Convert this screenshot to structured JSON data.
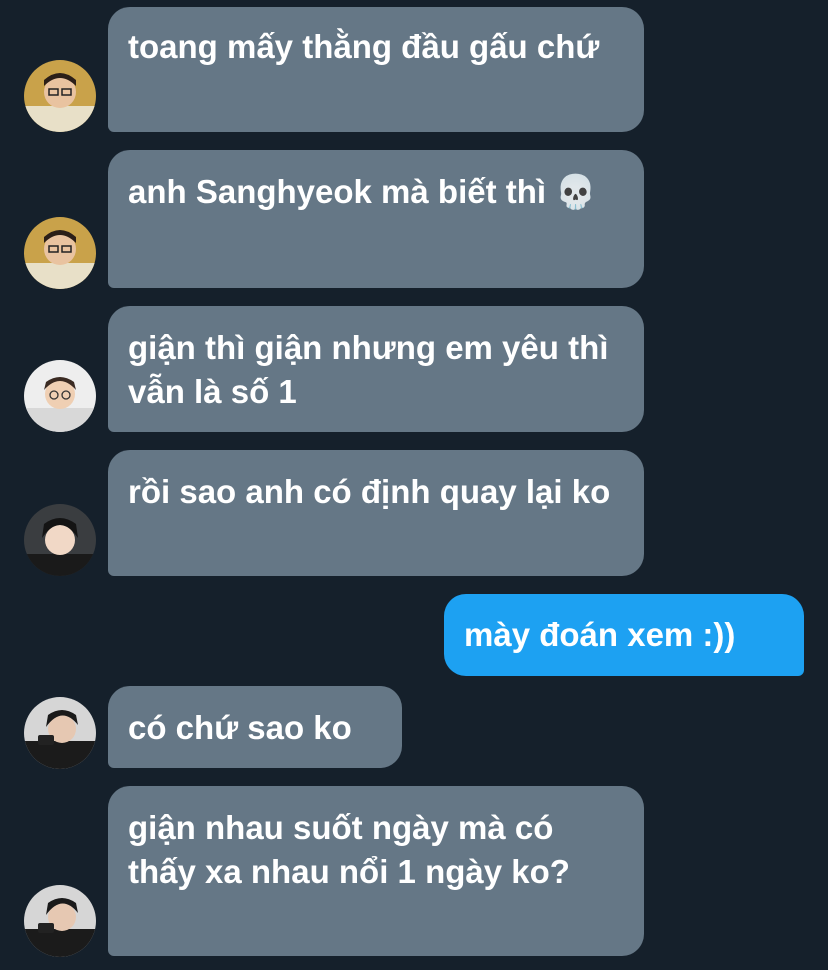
{
  "conversation": {
    "messages": [
      {
        "sender": "incoming",
        "text": "toang mấy thằng đầu gấu chứ"
      },
      {
        "sender": "incoming",
        "text": "anh Sanghyeok mà biết thì 💀"
      },
      {
        "sender": "incoming",
        "text": "giận thì giận nhưng em yêu thì vẫn là số 1"
      },
      {
        "sender": "incoming",
        "text": "rồi sao anh có định quay lại ko"
      },
      {
        "sender": "outgoing",
        "text": "mày đoán xem :))"
      },
      {
        "sender": "incoming",
        "text": "có chứ sao ko"
      },
      {
        "sender": "incoming",
        "text": "giận nhau suốt ngày mà có thấy xa nhau nổi 1 ngày ko?"
      }
    ]
  },
  "theme": {
    "background": "#15202b",
    "incoming_bubble": "#657786",
    "outgoing_bubble": "#1da1f2",
    "text": "#ffffff"
  }
}
